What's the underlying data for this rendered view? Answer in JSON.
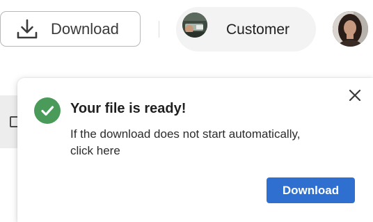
{
  "toolbar": {
    "download_label": "Download",
    "customer_label": "Customer",
    "download_icon": "download-icon",
    "customer_avatar_icon": "customer-avatar",
    "user_avatar_icon": "user-avatar"
  },
  "toast": {
    "title": "Your file is ready!",
    "message_line1": "If the download does not start automatically,",
    "message_link": "click here",
    "button_label": "Download",
    "status_icon": "check-circle-icon",
    "close_icon": "close-icon"
  },
  "colors": {
    "success": "#4a9a5a",
    "primary_button": "#2f6fcf",
    "pill_background": "#f3f3f3",
    "border": "#b8b8b8"
  }
}
